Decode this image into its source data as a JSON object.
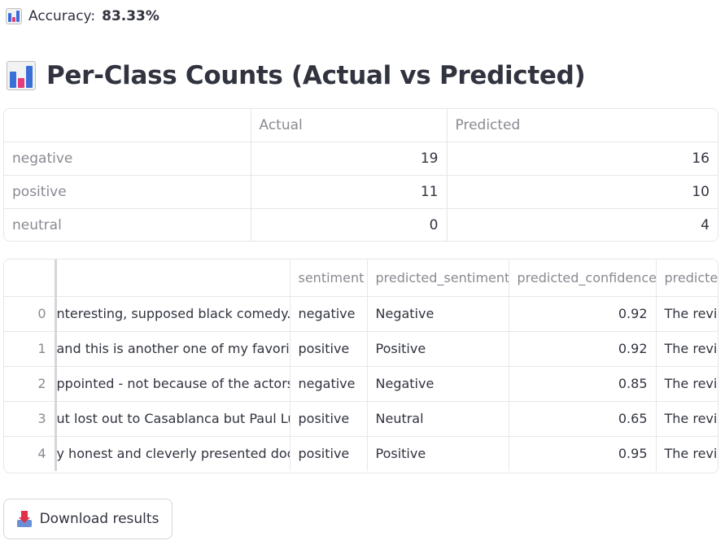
{
  "accuracy": {
    "icon": "bar-chart-icon",
    "label": "Accuracy:",
    "value": "83.33%"
  },
  "heading": {
    "icon": "bar-chart-icon",
    "text": "Per-Class Counts (Actual vs Predicted)"
  },
  "counts_table": {
    "columns": [
      "",
      "Actual",
      "Predicted"
    ],
    "rows": [
      {
        "label": "negative",
        "actual": "19",
        "predicted": "16"
      },
      {
        "label": "positive",
        "actual": "11",
        "predicted": "10"
      },
      {
        "label": "neutral",
        "actual": "0",
        "predicted": "4"
      }
    ]
  },
  "results_table": {
    "columns": [
      "",
      "",
      "sentiment",
      "predicted_sentiment",
      "predicted_confidence",
      "predicted"
    ],
    "rows": [
      {
        "index": "0",
        "review": "nteresting, supposed black comedy. Ess",
        "sentiment": "negative",
        "predicted_sentiment": "Negative",
        "predicted_confidence": "0.92",
        "explanation": "The revie"
      },
      {
        "index": "1",
        "review": "and this is another one of my favorites. I",
        "sentiment": "positive",
        "predicted_sentiment": "Positive",
        "predicted_confidence": "0.92",
        "explanation": "The revie"
      },
      {
        "index": "2",
        "review": "ppointed - not because of the actors, sto",
        "sentiment": "negative",
        "predicted_sentiment": "Negative",
        "predicted_confidence": "0.85",
        "explanation": "The revie"
      },
      {
        "index": "3",
        "review": "ut lost out to Casablanca but Paul Lukas",
        "sentiment": "positive",
        "predicted_sentiment": "Neutral",
        "predicted_confidence": "0.65",
        "explanation": "The revie"
      },
      {
        "index": "4",
        "review": "y honest and cleverly presented docume",
        "sentiment": "positive",
        "predicted_sentiment": "Positive",
        "predicted_confidence": "0.95",
        "explanation": "The revie"
      }
    ]
  },
  "download": {
    "icon": "inbox-tray-icon",
    "label": "Download results"
  }
}
